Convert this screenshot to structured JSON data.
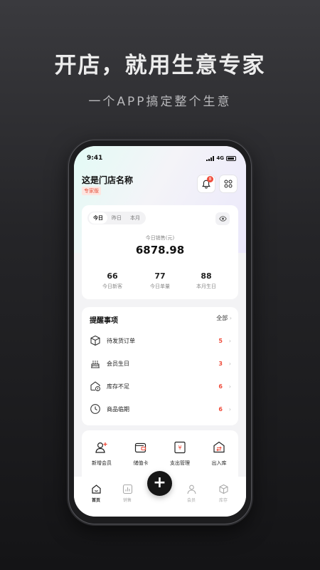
{
  "promo": {
    "headline": "开店，就用生意专家",
    "subline": "一个APP搞定整个生意"
  },
  "status_bar": {
    "time": "9:41",
    "network": "4G"
  },
  "header": {
    "store_name": "这是门店名称",
    "edition_badge": "专家版",
    "notification_count": "8"
  },
  "sales": {
    "periods": [
      "今日",
      "昨日",
      "本月"
    ],
    "selected_period": "今日",
    "label": "今日销售(元)",
    "value": "6878.98",
    "stats": [
      {
        "value": "66",
        "label": "今日新客"
      },
      {
        "value": "77",
        "label": "今日单量"
      },
      {
        "value": "88",
        "label": "本月生日"
      }
    ]
  },
  "reminders": {
    "title": "提醒事项",
    "all_label": "全部",
    "items": [
      {
        "label": "待发货订单",
        "count": "5",
        "icon": "box-icon"
      },
      {
        "label": "会员生日",
        "count": "3",
        "icon": "cake-icon"
      },
      {
        "label": "库存不足",
        "count": "6",
        "icon": "low-stock-icon"
      },
      {
        "label": "商品临期",
        "count": "6",
        "icon": "clock-icon"
      }
    ]
  },
  "quick_actions": [
    {
      "label": "新增会员",
      "icon": "add-member-icon"
    },
    {
      "label": "储值卡",
      "icon": "wallet-icon"
    },
    {
      "label": "支出管理",
      "icon": "expense-icon"
    },
    {
      "label": "出入库",
      "icon": "inventory-icon"
    }
  ],
  "tabs": [
    {
      "label": "首页",
      "icon": "home-icon",
      "active": true
    },
    {
      "label": "销售",
      "icon": "chart-icon",
      "active": false
    },
    {
      "label": "会员",
      "icon": "person-icon",
      "active": false
    },
    {
      "label": "库存",
      "icon": "cube-icon",
      "active": false
    }
  ],
  "colors": {
    "accent_red": "#ef4b3a",
    "fab": "#161616"
  }
}
